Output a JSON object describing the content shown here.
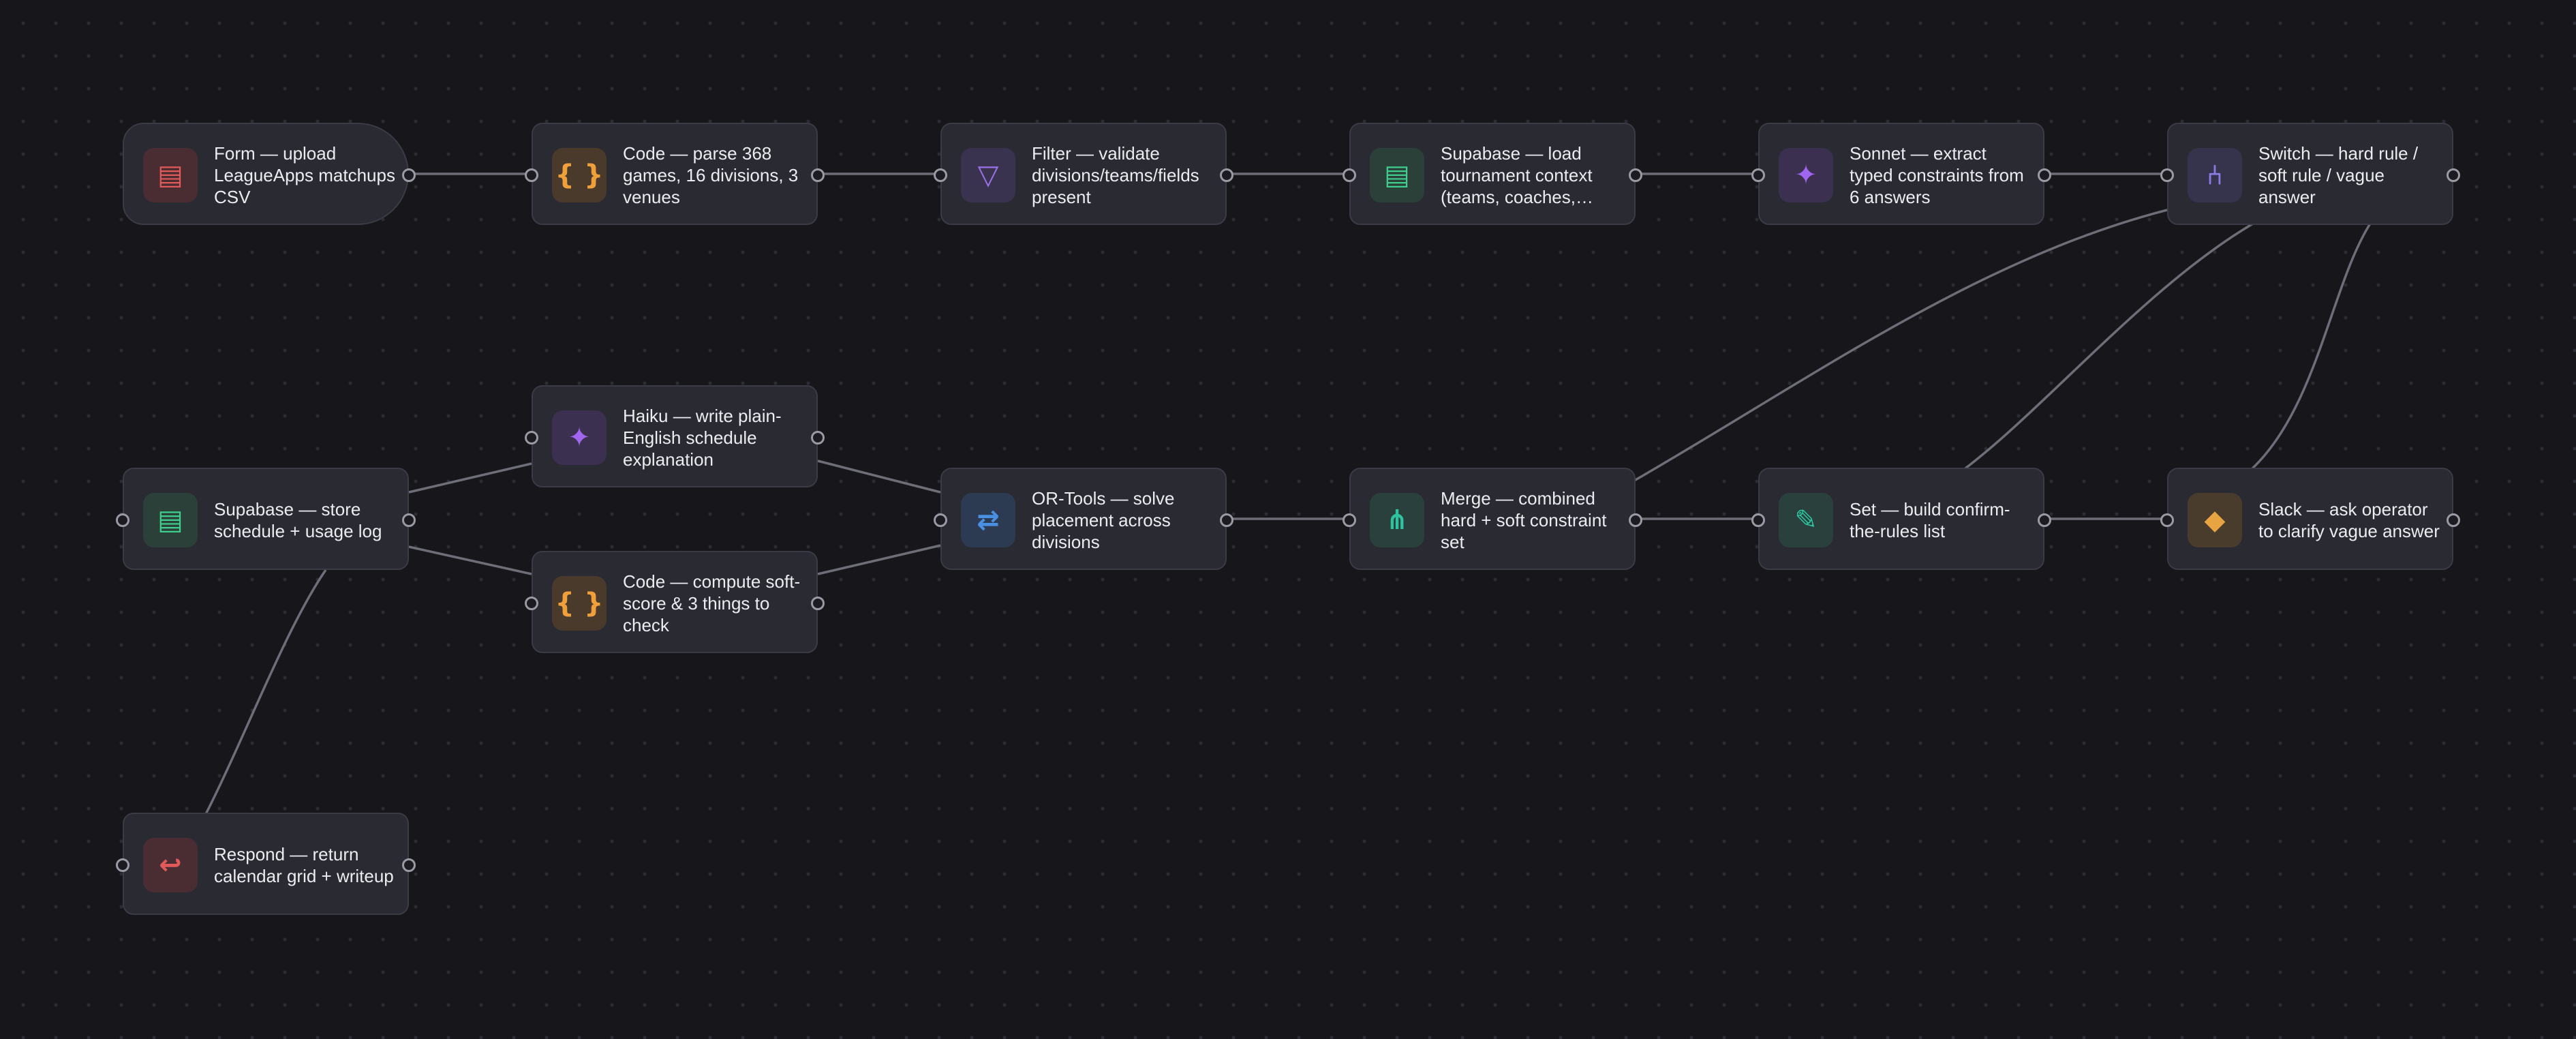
{
  "nodes": [
    {
      "id": "form",
      "label": "Form — upload LeagueApps matchups CSV",
      "icon": "table-icon",
      "glyph": "▤",
      "color": "#e05a5a",
      "tile": "#4a2c33"
    },
    {
      "id": "code_parse",
      "label": "Code — parse 368 games, 16 divisions, 3 venues",
      "icon": "braces-icon",
      "glyph": "{ }",
      "color": "#f0a03a",
      "tile": "#4a3a2c"
    },
    {
      "id": "filter",
      "label": "Filter — validate divisions/teams/fields present",
      "icon": "filter-icon",
      "glyph": "▽",
      "color": "#9a72e8",
      "tile": "#3a3350"
    },
    {
      "id": "supabase_load",
      "label": "Supabase — load tournament context (teams, coaches, fields)",
      "icon": "database-icon",
      "glyph": "▤",
      "color": "#3ecf8e",
      "tile": "#2a4038"
    },
    {
      "id": "sonnet",
      "label": "Sonnet — extract typed constraints from 6 answers",
      "icon": "sparkle-icon",
      "glyph": "✦",
      "color": "#a066f0",
      "tile": "#3c3050"
    },
    {
      "id": "switch",
      "label": "Switch — hard rule / soft rule / vague answer",
      "icon": "branch-icon",
      "glyph": "⑃",
      "color": "#8a7ae0",
      "tile": "#36334c"
    },
    {
      "id": "haiku",
      "label": "Haiku — write plain-English schedule explanation",
      "icon": "sparkle-icon",
      "glyph": "✦",
      "color": "#a066f0",
      "tile": "#3c3050"
    },
    {
      "id": "supabase_store",
      "label": "Supabase — store schedule + usage log",
      "icon": "database-icon",
      "glyph": "▤",
      "color": "#3ecf8e",
      "tile": "#2a4038"
    },
    {
      "id": "code_score",
      "label": "Code — compute soft-score & 3 things to check",
      "icon": "braces-icon",
      "glyph": "{ }",
      "color": "#f0a03a",
      "tile": "#4a3a2c"
    },
    {
      "id": "ortools",
      "label": "OR-Tools — solve placement across divisions",
      "icon": "swap-arrows-icon",
      "glyph": "⇄",
      "color": "#4a90e2",
      "tile": "#2c3a52"
    },
    {
      "id": "merge",
      "label": "Merge — combined hard + soft constraint set",
      "icon": "merge-icon",
      "glyph": "⋔",
      "color": "#2ec4a0",
      "tile": "#2a403c"
    },
    {
      "id": "set",
      "label": "Set — build confirm-the-rules list",
      "icon": "pencil-icon",
      "glyph": "✎",
      "color": "#2ec4a0",
      "tile": "#2a403c"
    },
    {
      "id": "slack",
      "label": "Slack — ask operator to clarify vague answer",
      "icon": "diamond-icon",
      "glyph": "◆",
      "color": "#e8a440",
      "tile": "#4a3c2c"
    },
    {
      "id": "respond",
      "label": "Respond — return calendar grid + writeup",
      "icon": "return-arrow-icon",
      "glyph": "↩",
      "color": "#e05a5a",
      "tile": "#4a2c33"
    }
  ],
  "edges": [
    [
      "form",
      "code_parse"
    ],
    [
      "code_parse",
      "filter"
    ],
    [
      "filter",
      "supabase_load"
    ],
    [
      "supabase_load",
      "sonnet"
    ],
    [
      "sonnet",
      "switch"
    ],
    [
      "switch",
      "merge"
    ],
    [
      "switch",
      "set"
    ],
    [
      "switch",
      "slack"
    ],
    [
      "merge",
      "set"
    ],
    [
      "set",
      "slack"
    ],
    [
      "merge",
      "ortools"
    ],
    [
      "ortools",
      "haiku"
    ],
    [
      "ortools",
      "code_score"
    ],
    [
      "haiku",
      "supabase_store"
    ],
    [
      "code_score",
      "supabase_store"
    ],
    [
      "supabase_store",
      "respond"
    ]
  ]
}
